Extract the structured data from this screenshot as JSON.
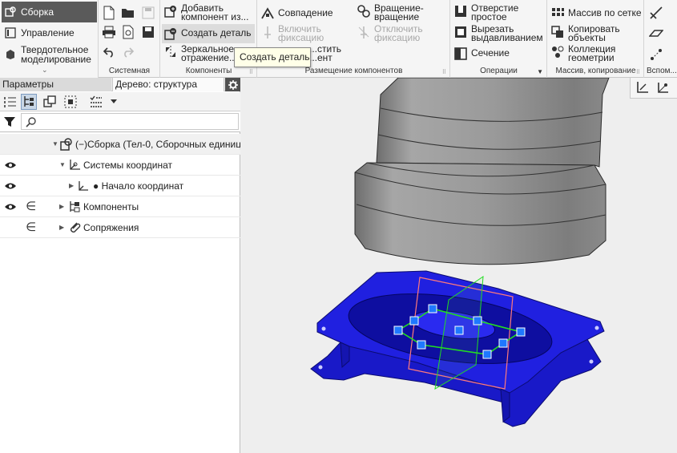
{
  "modes": {
    "active": "Сборка",
    "items": [
      "Управление",
      "Твердотельное моделирование"
    ],
    "more": "⌄"
  },
  "ribbon": {
    "groups": {
      "system": "Системная",
      "components": "Компоненты",
      "placement": "Размещение компонентов",
      "operations": "Операции",
      "patterns": "Массив, копирование",
      "aux": "Вспом..."
    },
    "components": {
      "add": [
        "Добавить",
        "компонент из..."
      ],
      "create": "Создать деталь",
      "mirror": [
        "Зеркальное",
        "отражение..."
      ]
    },
    "placement": {
      "coincidence": "Совпадение",
      "rotation": [
        "Вращение-",
        "вращение"
      ],
      "enable_fix": [
        "Включить",
        "фиксацию"
      ],
      "disable_fix": [
        "Отключить",
        "фиксацию"
      ],
      "place_partial": [
        "...стить",
        "...ент"
      ]
    },
    "operations": {
      "hole": [
        "Отверстие",
        "простое"
      ],
      "cut": [
        "Вырезать",
        "выдавливанием"
      ],
      "section": "Сечение"
    },
    "patterns": {
      "grid": "Массив по сетке",
      "copy": [
        "Копировать",
        "объекты"
      ],
      "collection": [
        "Коллекция",
        "геометрии"
      ]
    }
  },
  "tooltip": "Создать деталь",
  "panel": {
    "tab_params": "Параметры",
    "tab_tree": "Дерево: структура",
    "search_placeholder": ""
  },
  "tree": [
    {
      "label": "(−)Сборка (Тел-0, Сборочных единиц",
      "icon": "assembly-icon",
      "level": 0,
      "visible": false,
      "included": false
    },
    {
      "label": "Системы координат",
      "icon": "coordinate-systems-icon",
      "level": 1,
      "visible": true,
      "included": false
    },
    {
      "label": "● Начало координат",
      "icon": "origin-icon",
      "level": 2,
      "visible": true,
      "included": false
    },
    {
      "label": "Компоненты",
      "icon": "components-icon",
      "level": 1,
      "visible": true,
      "included": true
    },
    {
      "label": "Сопряжения",
      "icon": "mates-icon",
      "level": 1,
      "visible": false,
      "included": true
    }
  ],
  "tree_symbols": {
    "eye": "👁",
    "include": "∈"
  },
  "colors": {
    "active_mode": "#5a5a5a",
    "part_blue": "#1a1ad8",
    "cylinder_gray": "#9a9a9a",
    "selection_green": "#22dd22",
    "plane_red": "#ff7a7a",
    "handle_blue": "#1e78ff"
  }
}
